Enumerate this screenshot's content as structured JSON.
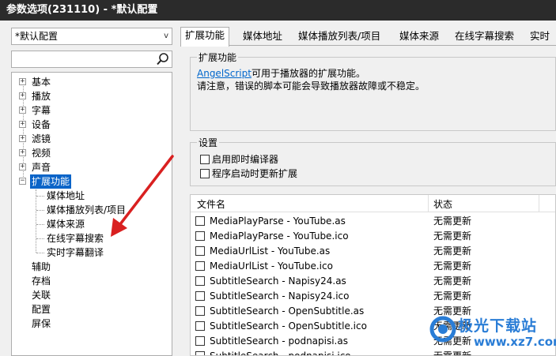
{
  "window": {
    "title": "参数选项(231110) - *默认配置"
  },
  "profile": {
    "selected": "*默认配置"
  },
  "search": {
    "value": ""
  },
  "tree": {
    "items": [
      {
        "label": "基本",
        "expander": "+"
      },
      {
        "label": "播放",
        "expander": "+"
      },
      {
        "label": "字幕",
        "expander": "+"
      },
      {
        "label": "设备",
        "expander": "+"
      },
      {
        "label": "滤镜",
        "expander": "+"
      },
      {
        "label": "视频",
        "expander": "+"
      },
      {
        "label": "声音",
        "expander": "+"
      },
      {
        "label": "扩展功能",
        "expander": "−",
        "selected": true
      }
    ],
    "children": [
      "媒体地址",
      "媒体播放列表/项目",
      "媒体来源",
      "在线字幕搜索",
      "实时字幕翻译"
    ],
    "tail": [
      "辅助",
      "存档",
      "关联",
      "配置",
      "屏保"
    ]
  },
  "tabs": [
    "扩展功能",
    "媒体地址",
    "媒体播放列表/项目",
    "媒体来源",
    "在线字幕搜索",
    "实时"
  ],
  "ext": {
    "group_title": "扩展功能",
    "link_text": "AngelScript",
    "desc1": "可用于播放器的扩展功能。",
    "desc2": "请注意，错误的脚本可能会导致播放器故障或不稳定。"
  },
  "settings": {
    "group_title": "设置",
    "opt1": "启用即时编译器",
    "opt2": "程序启动时更新扩展"
  },
  "filelist": {
    "col_file": "文件名",
    "col_status": "状态",
    "rows": [
      {
        "name": "MediaPlayParse - YouTube.as",
        "status": "无需更新"
      },
      {
        "name": "MediaPlayParse - YouTube.ico",
        "status": "无需更新"
      },
      {
        "name": "MediaUrlList - YouTube.as",
        "status": "无需更新"
      },
      {
        "name": "MediaUrlList - YouTube.ico",
        "status": "无需更新"
      },
      {
        "name": "SubtitleSearch - Napisy24.as",
        "status": "无需更新"
      },
      {
        "name": "SubtitleSearch - Napisy24.ico",
        "status": "无需更新"
      },
      {
        "name": "SubtitleSearch - OpenSubtitle.as",
        "status": "无需更新"
      },
      {
        "name": "SubtitleSearch - OpenSubtitle.ico",
        "status": "无需更新"
      },
      {
        "name": "SubtitleSearch - podnapisi.as",
        "status": "无需更新"
      },
      {
        "name": "SubtitleSearch - podnapisi.ico",
        "status": "无需更新"
      }
    ]
  },
  "watermark": {
    "line1": "极光下载站",
    "line2": "www.xz7.com"
  },
  "colors": {
    "selection": "#0a64c8",
    "link": "#0066cc",
    "arrow": "#d92020",
    "titlebar": "#2b2b2b"
  }
}
